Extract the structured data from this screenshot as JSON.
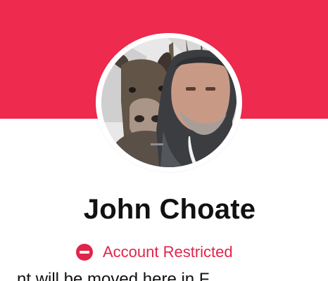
{
  "profile": {
    "name": "John Choate",
    "status": {
      "label": "Account Restricted",
      "icon": "minus-circle-icon",
      "color": "#e0254a"
    },
    "truncated_text": "...nt will be moved here in F..."
  },
  "colors": {
    "cover": "#ee2a4e",
    "text": "#111111",
    "background": "#ffffff"
  }
}
